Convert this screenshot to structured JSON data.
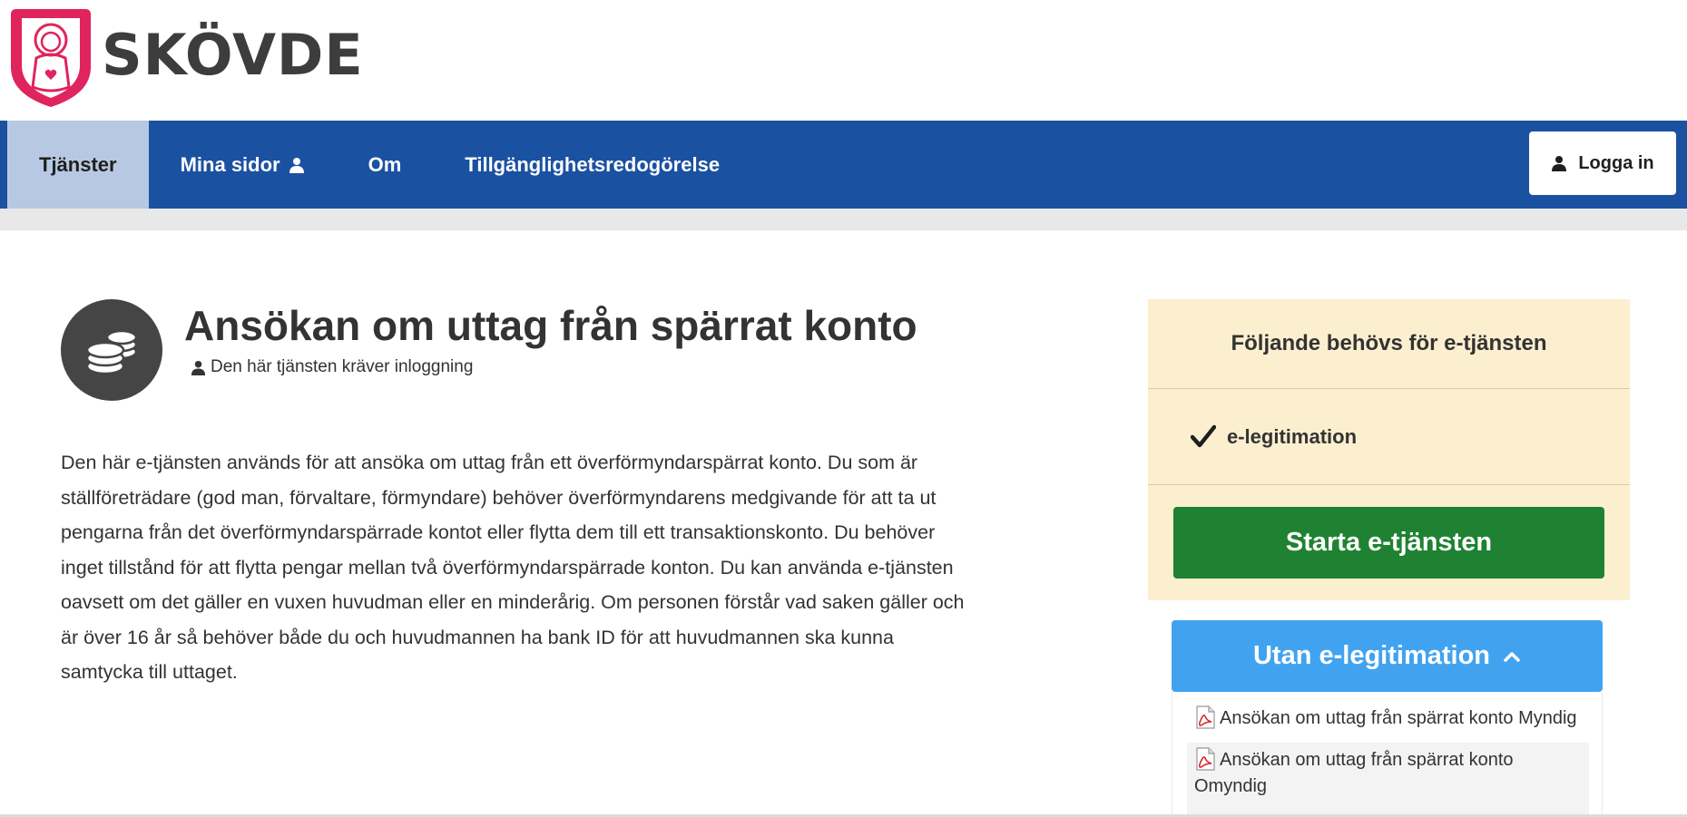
{
  "brand": {
    "name": "SKÖVDE",
    "primary_color": "#1b51a1",
    "logo_color": "#e0245e"
  },
  "nav": {
    "items": [
      {
        "label": "Tjänster",
        "active": true
      },
      {
        "label": "Mina sidor",
        "active": false
      },
      {
        "label": "Om",
        "active": false
      },
      {
        "label": "Tillgänglighetsredogörelse",
        "active": false
      }
    ],
    "login_label": "Logga in"
  },
  "service": {
    "icon": "coins-icon",
    "title": "Ansökan om uttag från spärrat konto",
    "login_note": "Den här tjänsten kräver inloggning",
    "description": "Den här e-tjänsten används för att ansöka om uttag från ett överförmyndarspärrat konto. Du som är ställföreträdare (god man, förvaltare, förmyndare) behöver överförmyndarens medgivande för att ta ut pengarna från det överförmyndarspärrade kontot eller flytta dem till ett transaktionskonto. Du behöver inget tillstånd för att flytta pengar mellan två överförmyndarspärrade konton. Du kan använda e-tjänsten oavsett om det gäller en vuxen huvudman eller en minderårig. Om personen förstår vad saken gäller och är över 16 år så behöver både du och huvudmannen ha bank ID för att huvudmannen ska kunna samtycka till uttaget."
  },
  "requirements": {
    "title": "Följande behövs för e-tjänsten",
    "item": "e-legitimation",
    "start_label": "Starta e-tjänsten",
    "start_color": "#1f8232"
  },
  "alternative": {
    "toggle_label": "Utan e-legitimation",
    "toggle_color": "#41a3f0",
    "documents": [
      "Ansökan om uttag från spärrat konto Myndig",
      "Ansökan om uttag från spärrat konto Omyndig"
    ]
  }
}
